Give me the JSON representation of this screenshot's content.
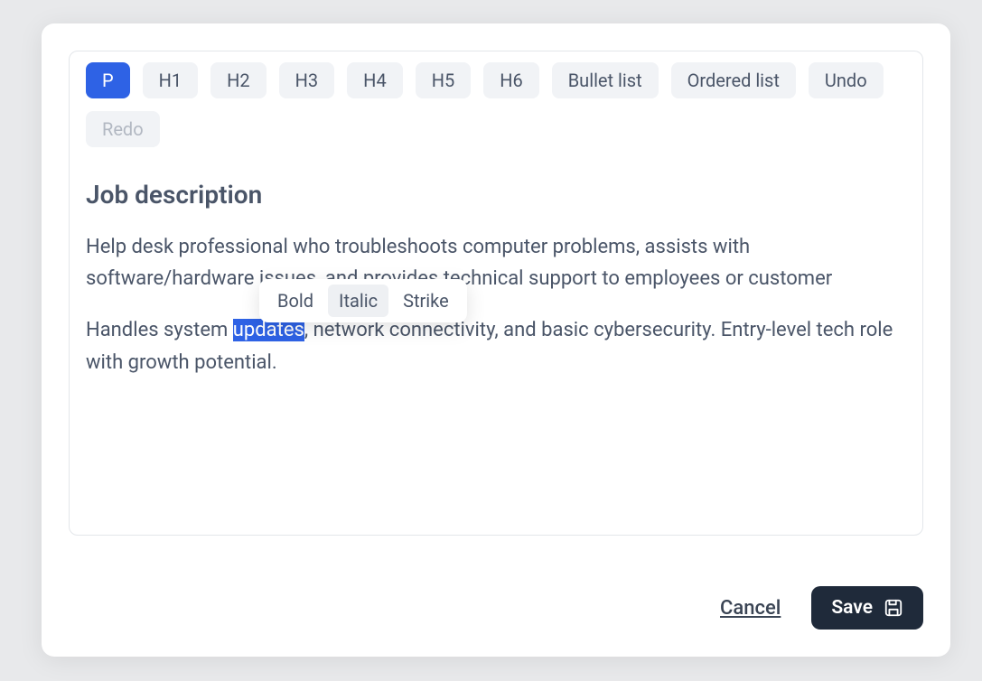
{
  "toolbar": {
    "p_label": "P",
    "h1_label": "H1",
    "h2_label": "H2",
    "h3_label": "H3",
    "h4_label": "H4",
    "h5_label": "H5",
    "h6_label": "H6",
    "bullet_label": "Bullet list",
    "ordered_label": "Ordered list",
    "undo_label": "Undo",
    "redo_label": "Redo"
  },
  "editor": {
    "heading": "Job description",
    "p1": "Help desk professional who troubleshoots computer problems, assists with software/hardware issues, and provides technical support to employees or customer",
    "p2_pre": "Handles system ",
    "p2_selected": "updates",
    "p2_post": ", network connectivity, and basic cybersecurity. Entry-level tech role with growth potential."
  },
  "bubble": {
    "bold_label": "Bold",
    "italic_label": "Italic",
    "strike_label": "Strike"
  },
  "footer": {
    "cancel_label": "Cancel",
    "save_label": "Save"
  }
}
